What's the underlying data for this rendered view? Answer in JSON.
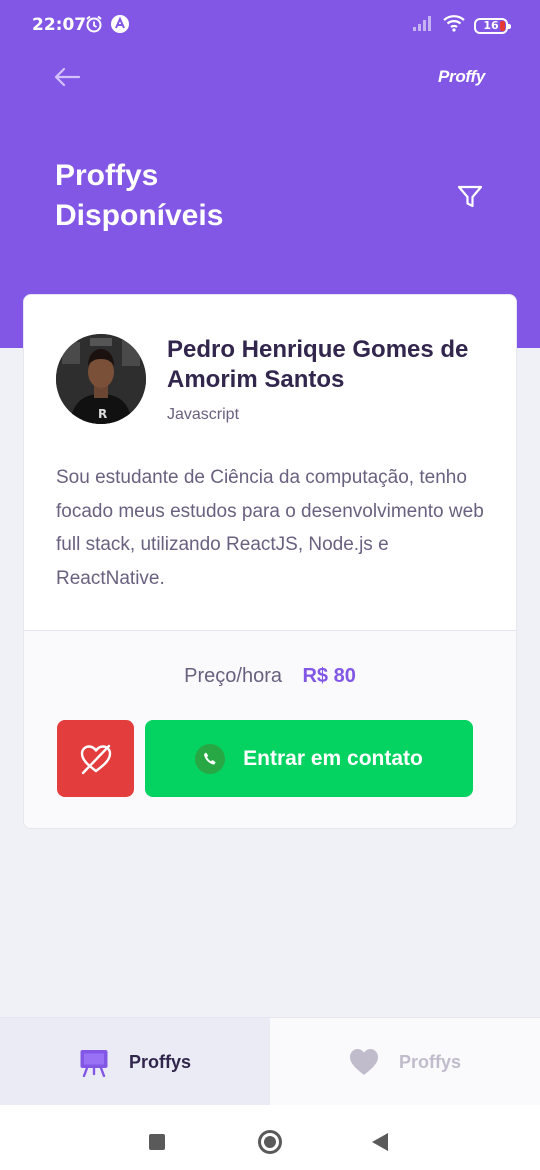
{
  "status_bar": {
    "time": "22:07",
    "battery": "16",
    "icons": [
      "alarm-icon",
      "app-notification-icon",
      "signal-icon",
      "wifi-icon",
      "battery-icon"
    ]
  },
  "header": {
    "brand": "Proffy",
    "title_line1": "Proffys",
    "title_line2": "Disponíveis",
    "back_icon": "arrow-left-icon",
    "filter_icon": "filter-icon"
  },
  "teacher_card": {
    "name": "Pedro Henrique Gomes de Amorim Santos",
    "subject": "Javascript",
    "bio": "Sou estudante de Ciência da computação, tenho focado meus estudos para o desenvolvimento web full stack, utilizando ReactJS, Node.js e ReactNative.",
    "price_label": "Preço/hora",
    "price_value": "R$ 80",
    "favorite_icon": "heart-outline-icon",
    "contact_label": "Entrar em contato",
    "contact_icon": "whatsapp-icon"
  },
  "tabs": [
    {
      "label": "Proffys",
      "icon": "easel-icon",
      "active": true
    },
    {
      "label": "Proffys",
      "icon": "heart-icon",
      "active": false
    }
  ],
  "colors": {
    "primary": "#8257E5",
    "title_text": "#32264D",
    "body_text": "#6A6180",
    "favorite": "#E33D3D",
    "contact": "#04D361",
    "background": "#F0F0F7"
  }
}
